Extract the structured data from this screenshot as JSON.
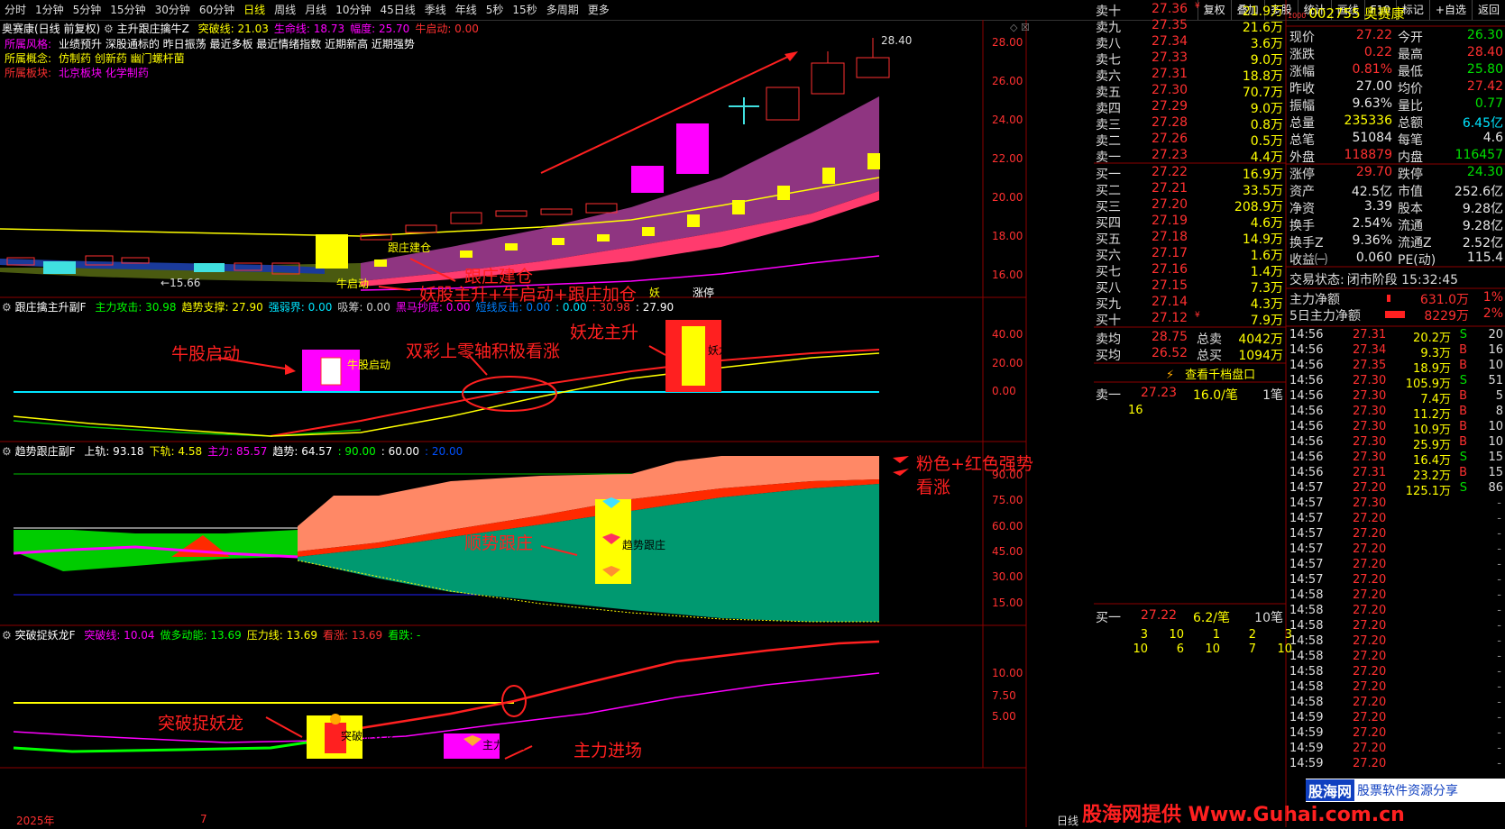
{
  "toolbar": {
    "periods": [
      "分时",
      "1分钟",
      "5分钟",
      "15分钟",
      "30分钟",
      "60分钟",
      "日线",
      "周线",
      "月线",
      "10分钟",
      "45日线",
      "季线",
      "年线",
      "5秒",
      "15秒",
      "多周期",
      "更多"
    ],
    "active": "日线",
    "right_buttons": [
      "复权",
      "叠加",
      "多股",
      "统计",
      "画线",
      "F10",
      "标记",
      "+自选",
      "返回"
    ]
  },
  "main_pane": {
    "title": "奥赛康(日线 前复权)",
    "indicator": "主升跟庄擒牛Z",
    "params": [
      {
        "label": "突破线: 21.03",
        "color": "#ffff00"
      },
      {
        "label": "生命线: 18.73",
        "color": "#ff00ff"
      },
      {
        "label": "幅度: 25.70",
        "color": "#ff00ff"
      },
      {
        "label": "牛启动: 0.00",
        "color": "#ff3030"
      }
    ],
    "info_lines": [
      {
        "label": "所属风格:",
        "value": "业绩预升 深股通标的 昨日振荡 最近多板 最近情绪指数 近期新高 近期强势",
        "label_color": "#ff00ff",
        "value_color": "#ffffff"
      },
      {
        "label": "所属概念:",
        "value": "仿制药 创新药 幽门螺杆菌",
        "label_color": "#ffff00",
        "value_color": "#ffff00"
      },
      {
        "label": "所属板块:",
        "value": "北京板块  化学制药",
        "label_color": "#ff3030",
        "value_color": "#ff00ff"
      }
    ],
    "y_ticks": [
      "28.00",
      "26.00",
      "24.00",
      "22.00",
      "20.00",
      "18.00",
      "16.00"
    ],
    "high_label": "28.40",
    "low_label": "15.66",
    "signal_labels": {
      "build": "跟庄建仓",
      "start": "牛启动",
      "zt": "涨停",
      "yao": "妖"
    },
    "annotations": {
      "build": "跟庄建仓",
      "combo": "妖股主升+牛启动+跟庄加仓"
    }
  },
  "sub1": {
    "indicator": "跟庄擒主升副F",
    "params": [
      {
        "label": "主力攻击: 30.98",
        "color": "#00ff00"
      },
      {
        "label": "趋势支撑: 27.90",
        "color": "#ffff00"
      },
      {
        "label": "强弱界: 0.00",
        "color": "#00e5ff"
      },
      {
        "label": "吸筹: 0.00",
        "color": "#cccccc"
      },
      {
        "label": "黑马抄底: 0.00",
        "color": "#ff00ff"
      },
      {
        "label": "短线反击: 0.00",
        "color": "#0080ff"
      },
      {
        "label": ": 0.00",
        "color": "#00e5ff"
      },
      {
        "label": ": 30.98",
        "color": "#ff3030"
      },
      {
        "label": ": 27.90",
        "color": "#ffffff"
      }
    ],
    "y_ticks": [
      "40.00",
      "20.00",
      "0.00"
    ],
    "bar_labels": {
      "bull": "牛股启动",
      "yao": "妖龙主升"
    },
    "annotations": {
      "bull": "牛股启动",
      "zero": "双彩上零轴积极看涨",
      "yao": "妖龙主升"
    }
  },
  "sub2": {
    "indicator": "趋势跟庄副F",
    "params": [
      {
        "label": "上轨: 93.18",
        "color": "#ffffff"
      },
      {
        "label": "下轨: 4.58",
        "color": "#ffff00"
      },
      {
        "label": "主力: 85.57",
        "color": "#ff00ff"
      },
      {
        "label": "趋势: 64.57",
        "color": "#ffffff"
      },
      {
        "label": ": 90.00",
        "color": "#00ff00"
      },
      {
        "label": ": 60.00",
        "color": "#ffffff"
      },
      {
        "label": ": 20.00",
        "color": "#0050ff"
      }
    ],
    "y_ticks": [
      "90.00",
      "75.00",
      "60.00",
      "45.00",
      "30.00",
      "15.00"
    ],
    "bar_label": "趋势跟庄",
    "annotations": {
      "pink1": "粉色+红色强势",
      "pink2": "看涨",
      "follow": "顺势跟庄"
    }
  },
  "sub3": {
    "indicator": "突破捉妖龙F",
    "params": [
      {
        "label": "突破线: 10.04",
        "color": "#ff00ff"
      },
      {
        "label": "做多动能: 13.69",
        "color": "#00ff00"
      },
      {
        "label": "压力线: 13.69",
        "color": "#ffff00"
      },
      {
        "label": "看涨: 13.69",
        "color": "#ff3030"
      },
      {
        "label": "看跌: -",
        "color": "#00ff00"
      }
    ],
    "y_ticks": [
      "10.00",
      "7.50",
      "5.00"
    ],
    "bar_labels": {
      "yao": "突破捉妖龙",
      "main": "主力进场"
    },
    "annotations": {
      "yao": "突破捉妖龙",
      "main": "主力进场"
    }
  },
  "bottom": {
    "year": "2025年",
    "month": "7",
    "period": "日线"
  },
  "orderbook": {
    "sells": [
      {
        "label": "卖十",
        "price": "27.36",
        "vol": "21.9万",
        "flag": "¥"
      },
      {
        "label": "卖九",
        "price": "27.35",
        "vol": "21.6万",
        "flag": ""
      },
      {
        "label": "卖八",
        "price": "27.34",
        "vol": "3.6万",
        "flag": ""
      },
      {
        "label": "卖七",
        "price": "27.33",
        "vol": "9.0万",
        "flag": ""
      },
      {
        "label": "卖六",
        "price": "27.31",
        "vol": "18.8万",
        "flag": ""
      },
      {
        "label": "卖五",
        "price": "27.30",
        "vol": "70.7万",
        "flag": ""
      },
      {
        "label": "卖四",
        "price": "27.29",
        "vol": "9.0万",
        "flag": ""
      },
      {
        "label": "卖三",
        "price": "27.28",
        "vol": "0.8万",
        "flag": ""
      },
      {
        "label": "卖二",
        "price": "27.26",
        "vol": "0.5万",
        "flag": ""
      },
      {
        "label": "卖一",
        "price": "27.23",
        "vol": "4.4万",
        "flag": ""
      }
    ],
    "buys": [
      {
        "label": "买一",
        "price": "27.22",
        "vol": "16.9万",
        "flag": ""
      },
      {
        "label": "买二",
        "price": "27.21",
        "vol": "33.5万",
        "flag": ""
      },
      {
        "label": "买三",
        "price": "27.20",
        "vol": "208.9万",
        "flag": ""
      },
      {
        "label": "买四",
        "price": "27.19",
        "vol": "4.6万",
        "flag": ""
      },
      {
        "label": "买五",
        "price": "27.18",
        "vol": "14.9万",
        "flag": ""
      },
      {
        "label": "买六",
        "price": "27.17",
        "vol": "1.6万",
        "flag": ""
      },
      {
        "label": "买七",
        "price": "27.16",
        "vol": "1.4万",
        "flag": ""
      },
      {
        "label": "买八",
        "price": "27.15",
        "vol": "7.3万",
        "flag": ""
      },
      {
        "label": "买九",
        "price": "27.14",
        "vol": "4.3万",
        "flag": ""
      },
      {
        "label": "买十",
        "price": "27.12",
        "vol": "7.9万",
        "flag": "¥"
      }
    ],
    "avg": [
      {
        "label": "卖均",
        "price": "28.75",
        "label2": "总卖",
        "vol": "4042万"
      },
      {
        "label": "买均",
        "price": "26.52",
        "label2": "总买",
        "vol": "1094万"
      }
    ],
    "qiandang": "查看千档盘口",
    "sell1": {
      "label": "卖一",
      "price": "27.23",
      "vol": "16.0/笔",
      "count": "1笔",
      "detail": "16"
    },
    "buy1": {
      "label": "买一",
      "price": "27.22",
      "vol": "6.2/笔",
      "count": "10笔",
      "detail1": [
        "3",
        "10",
        "1",
        "2",
        "3"
      ],
      "detail2": [
        "10",
        "6",
        "10",
        "7",
        "10"
      ]
    }
  },
  "quote": {
    "code": "002755",
    "name": "奥赛康",
    "tag": "1000",
    "rows": [
      [
        {
          "l": "现价",
          "v": "27.22",
          "c": "red"
        },
        {
          "l": "今开",
          "v": "26.30",
          "c": "grn"
        }
      ],
      [
        {
          "l": "涨跌",
          "v": "0.22",
          "c": "red"
        },
        {
          "l": "最高",
          "v": "28.40",
          "c": "red"
        }
      ],
      [
        {
          "l": "涨幅",
          "v": "0.81%",
          "c": "red"
        },
        {
          "l": "最低",
          "v": "25.80",
          "c": "grn"
        }
      ],
      [
        {
          "l": "昨收",
          "v": "27.00",
          "c": "wht"
        },
        {
          "l": "均价",
          "v": "27.42",
          "c": "red"
        }
      ],
      [
        {
          "l": "振幅",
          "v": "9.63%",
          "c": "wht"
        },
        {
          "l": "量比",
          "v": "0.77",
          "c": "grn"
        }
      ],
      [
        {
          "l": "总量",
          "v": "235336",
          "c": "yel"
        },
        {
          "l": "总额",
          "v": "6.45亿",
          "c": "cyan"
        }
      ],
      [
        {
          "l": "总笔",
          "v": "51084",
          "c": "wht"
        },
        {
          "l": "每笔",
          "v": "4.6",
          "c": "wht"
        }
      ],
      [
        {
          "l": "外盘",
          "v": "118879",
          "c": "red"
        },
        {
          "l": "内盘",
          "v": "116457",
          "c": "grn"
        }
      ]
    ],
    "rows2": [
      [
        {
          "l": "涨停",
          "v": "29.70",
          "c": "red"
        },
        {
          "l": "跌停",
          "v": "24.30",
          "c": "grn"
        }
      ],
      [
        {
          "l": "资产",
          "v": "42.5亿",
          "c": "wht"
        },
        {
          "l": "市值",
          "v": "252.6亿",
          "c": "wht"
        }
      ],
      [
        {
          "l": "净资",
          "v": "3.39",
          "c": "wht"
        },
        {
          "l": "股本",
          "v": "9.28亿",
          "c": "wht"
        }
      ],
      [
        {
          "l": "换手",
          "v": "2.54%",
          "c": "wht"
        },
        {
          "l": "流通",
          "v": "9.28亿",
          "c": "wht"
        }
      ],
      [
        {
          "l": "换手Z",
          "v": "9.36%",
          "c": "wht"
        },
        {
          "l": "流通Z",
          "v": "2.52亿",
          "c": "wht"
        }
      ],
      [
        {
          "l": "收益㈠",
          "v": "0.060",
          "c": "wht"
        },
        {
          "l": "PE(动)",
          "v": "115.4",
          "c": "wht"
        }
      ]
    ],
    "status_label": "交易状态:",
    "status_value": "闭市阶段 15:32:45",
    "net1": {
      "l": "主力净额",
      "v": "631.0万",
      "p": "1%"
    },
    "net2": {
      "l": "5日主力净额",
      "v": "8229万",
      "p": "2%"
    }
  },
  "ticks": [
    {
      "t": "14:56",
      "p": "27.31",
      "v": "20.2万",
      "s": "S",
      "n": "20",
      "pc": "red"
    },
    {
      "t": "14:56",
      "p": "27.34",
      "v": "9.3万",
      "s": "B",
      "n": "16",
      "pc": "red"
    },
    {
      "t": "14:56",
      "p": "27.35",
      "v": "18.9万",
      "s": "B",
      "n": "10",
      "pc": "red"
    },
    {
      "t": "14:56",
      "p": "27.30",
      "v": "105.9万",
      "s": "S",
      "n": "51",
      "pc": "red"
    },
    {
      "t": "14:56",
      "p": "27.30",
      "v": "7.4万",
      "s": "B",
      "n": "5",
      "pc": "red"
    },
    {
      "t": "14:56",
      "p": "27.30",
      "v": "11.2万",
      "s": "B",
      "n": "8",
      "pc": "red"
    },
    {
      "t": "14:56",
      "p": "27.30",
      "v": "10.9万",
      "s": "B",
      "n": "10",
      "pc": "red"
    },
    {
      "t": "14:56",
      "p": "27.30",
      "v": "25.9万",
      "s": "B",
      "n": "10",
      "pc": "red"
    },
    {
      "t": "14:56",
      "p": "27.30",
      "v": "16.4万",
      "s": "S",
      "n": "15",
      "pc": "red"
    },
    {
      "t": "14:56",
      "p": "27.31",
      "v": "23.2万",
      "s": "B",
      "n": "15",
      "pc": "red"
    },
    {
      "t": "14:57",
      "p": "27.20",
      "v": "125.1万",
      "s": "S",
      "n": "86",
      "pc": "red"
    },
    {
      "t": "14:57",
      "p": "27.30",
      "v": "",
      "s": "",
      "n": "",
      "pc": "red"
    },
    {
      "t": "14:57",
      "p": "27.20",
      "v": "",
      "s": "",
      "n": "",
      "pc": "red"
    },
    {
      "t": "14:57",
      "p": "27.20",
      "v": "",
      "s": "",
      "n": "",
      "pc": "red"
    },
    {
      "t": "14:57",
      "p": "27.20",
      "v": "",
      "s": "",
      "n": "",
      "pc": "red"
    },
    {
      "t": "14:57",
      "p": "27.20",
      "v": "",
      "s": "",
      "n": "",
      "pc": "red"
    },
    {
      "t": "14:57",
      "p": "27.20",
      "v": "",
      "s": "",
      "n": "",
      "pc": "red"
    },
    {
      "t": "14:58",
      "p": "27.20",
      "v": "",
      "s": "",
      "n": "",
      "pc": "red"
    },
    {
      "t": "14:58",
      "p": "27.20",
      "v": "",
      "s": "",
      "n": "",
      "pc": "red"
    },
    {
      "t": "14:58",
      "p": "27.20",
      "v": "",
      "s": "",
      "n": "",
      "pc": "red"
    },
    {
      "t": "14:58",
      "p": "27.20",
      "v": "",
      "s": "",
      "n": "",
      "pc": "red"
    },
    {
      "t": "14:58",
      "p": "27.20",
      "v": "",
      "s": "",
      "n": "",
      "pc": "red"
    },
    {
      "t": "14:58",
      "p": "27.20",
      "v": "",
      "s": "",
      "n": "",
      "pc": "red"
    },
    {
      "t": "14:58",
      "p": "27.20",
      "v": "",
      "s": "",
      "n": "",
      "pc": "red"
    },
    {
      "t": "14:58",
      "p": "27.20",
      "v": "",
      "s": "",
      "n": "",
      "pc": "red"
    },
    {
      "t": "14:59",
      "p": "27.20",
      "v": "",
      "s": "",
      "n": "",
      "pc": "red"
    },
    {
      "t": "14:59",
      "p": "27.20",
      "v": "",
      "s": "",
      "n": "",
      "pc": "red"
    },
    {
      "t": "14:59",
      "p": "27.20",
      "v": "",
      "s": "",
      "n": "",
      "pc": "red"
    },
    {
      "t": "14:59",
      "p": "27.20",
      "v": "",
      "s": "",
      "n": "",
      "pc": "red"
    }
  ],
  "watermark": {
    "left": "股海网提供 Www.Guhai.com.cn",
    "logo": "股海网",
    "right": "股票软件资源分享"
  },
  "colors": {
    "up": "#ff3030",
    "down": "#00e000",
    "accent": "#ffff00",
    "magenta": "#ff00ff"
  }
}
